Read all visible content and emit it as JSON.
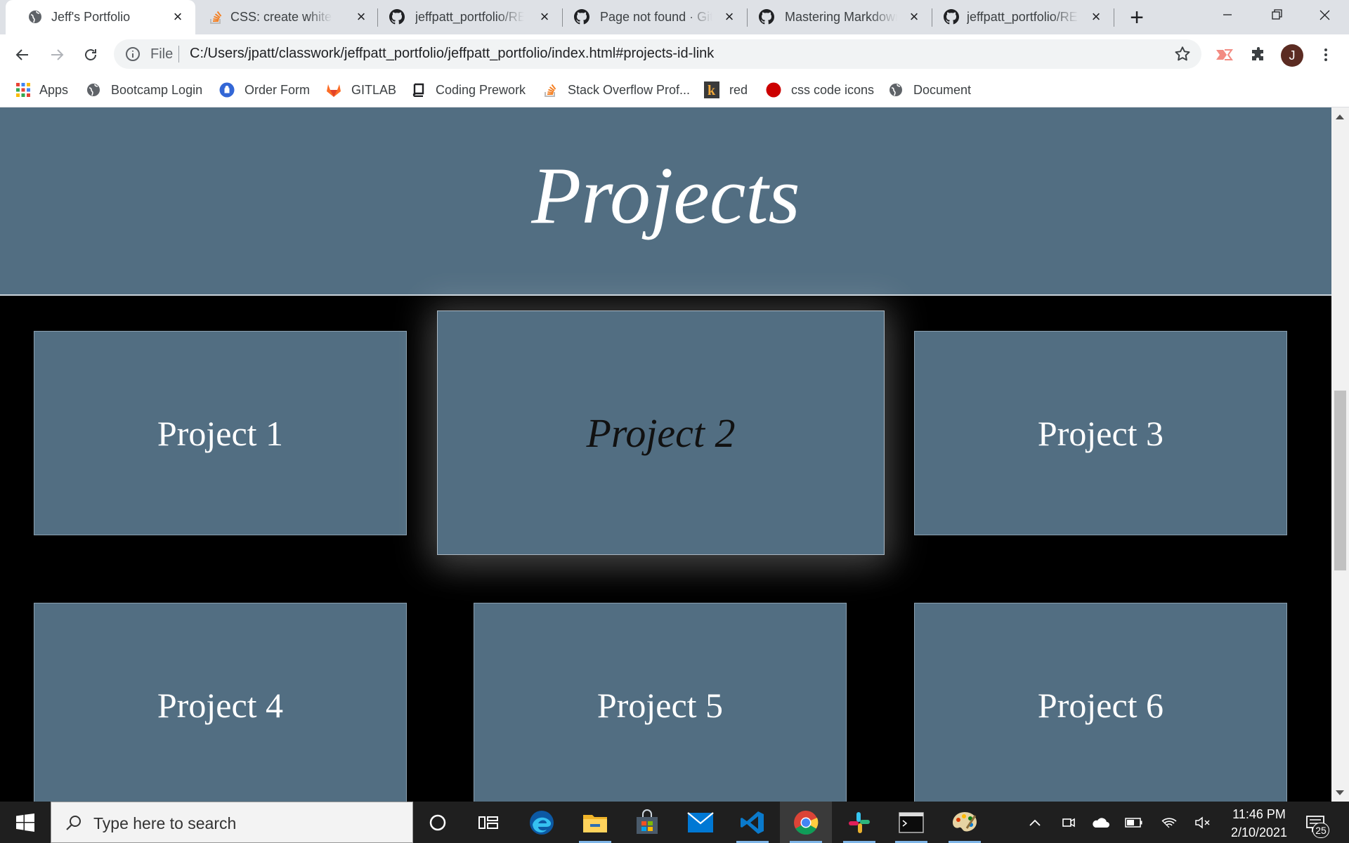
{
  "browser": {
    "tabs": [
      {
        "title": "Jeff's Portfolio",
        "icon": "globe-icon",
        "active": true
      },
      {
        "title": "CSS: create white glo",
        "icon": "stackoverflow-icon",
        "active": false
      },
      {
        "title": "jeffpatt_portfolio/RE",
        "icon": "github-icon",
        "active": false
      },
      {
        "title": "Page not found · Gith",
        "icon": "github-icon",
        "active": false
      },
      {
        "title": "Mastering Markdown",
        "icon": "github-icon",
        "active": false
      },
      {
        "title": "jeffpatt_portfolio/RE",
        "icon": "github-icon",
        "active": false
      }
    ],
    "address": {
      "scheme_label": "File",
      "url": "C:/Users/jpatt/classwork/jeffpatt_portfolio/jeffpatt_portfolio/index.html#projects-id-link"
    },
    "profile_initial": "J",
    "bookmarks": [
      {
        "label": "Apps",
        "icon": "apps-grid-icon"
      },
      {
        "label": "Bootcamp Login",
        "icon": "globe-icon"
      },
      {
        "label": "Order Form",
        "icon": "order-form-icon"
      },
      {
        "label": "GITLAB",
        "icon": "gitlab-icon"
      },
      {
        "label": "Coding Prework",
        "icon": "book-icon"
      },
      {
        "label": "Stack Overflow Prof...",
        "icon": "stackoverflow-icon"
      },
      {
        "label": "red",
        "icon": "k-logo-icon"
      },
      {
        "label": "css code icons",
        "icon": "red-circle-icon"
      },
      {
        "label": "Document",
        "icon": "globe-icon"
      }
    ]
  },
  "page": {
    "section_title": "Projects",
    "projects": [
      {
        "label": "Project 1"
      },
      {
        "label": "Project 2"
      },
      {
        "label": "Project 3"
      },
      {
        "label": "Project 4"
      },
      {
        "label": "Project 5"
      },
      {
        "label": "Project 6"
      }
    ],
    "colors": {
      "card": "#526e82",
      "background": "#000000",
      "hero": "#526e82"
    }
  },
  "taskbar": {
    "search_placeholder": "Type here to search",
    "time": "11:46 PM",
    "date": "2/10/2021",
    "notification_count": "25"
  }
}
